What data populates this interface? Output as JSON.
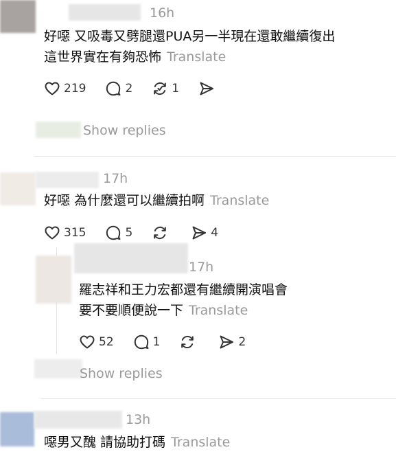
{
  "comments": [
    {
      "time": "16h",
      "line1": "好噁 又吸毒又劈腿還PUA另一半現在還敢繼續復出",
      "line2": "這世界實在有夠恐怖",
      "translate": "Translate",
      "likes": "219",
      "replies": "2",
      "reposts": "1",
      "shares": ""
    },
    {
      "time": "17h",
      "line1": "好噁 為什麼還可以繼續拍啊",
      "translate": "Translate",
      "likes": "315",
      "replies": "5",
      "reposts": "",
      "shares": "4"
    },
    {
      "time": "17h",
      "line1": "羅志祥和王力宏都還有繼續開演唱會",
      "line2": "要不要順便說一下",
      "translate": "Translate",
      "likes": "52",
      "replies": "1",
      "reposts": "",
      "shares": "2"
    },
    {
      "time": "13h",
      "line1": "噁男又醜 請協助打碼",
      "translate": "Translate"
    }
  ],
  "show_replies_label": "Show replies",
  "icons": [
    "heart-icon",
    "comment-icon",
    "repost-icon",
    "share-icon"
  ]
}
